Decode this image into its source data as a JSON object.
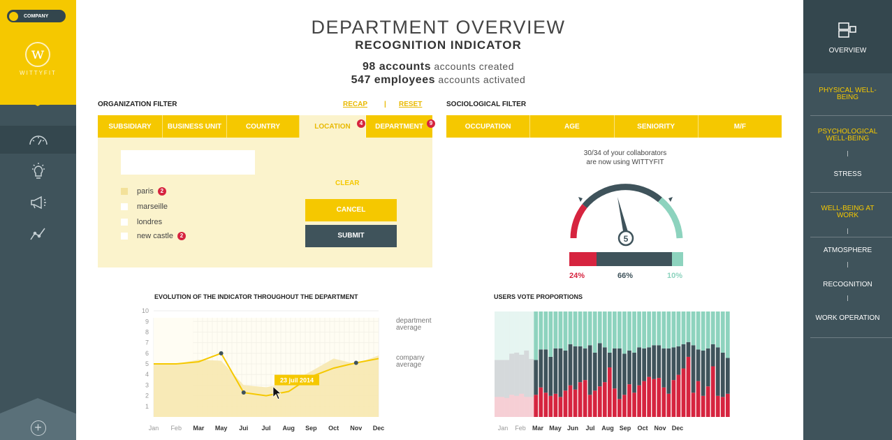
{
  "company_label": "COMPANY",
  "logo_text": "WITTYFIT",
  "header": {
    "title": "DEPARTMENT OVERVIEW",
    "subtitle": "RECOGNITION INDICATOR",
    "accounts_count": "98 accounts",
    "accounts_suffix": " accounts created",
    "employees_count": "547 employees",
    "employees_suffix": " accounts activated"
  },
  "org_filter": {
    "title": "ORGANIZATION FILTER",
    "recap": "RECAP",
    "separator": "|",
    "reset": "RESET",
    "tabs": [
      {
        "label": "SUBSIDIARY"
      },
      {
        "label": "BUSINESS UNIT"
      },
      {
        "label": "COUNTRY"
      },
      {
        "label": "LOCATION",
        "badge": "4"
      },
      {
        "label": "DEPARTMENT",
        "badge": "9"
      }
    ],
    "search_value": "",
    "locations": [
      {
        "label": "paris",
        "badge": "2",
        "checked": true
      },
      {
        "label": "marseille",
        "checked": false
      },
      {
        "label": "londres",
        "checked": false
      },
      {
        "label": "new castle",
        "badge": "2",
        "checked": false
      }
    ],
    "clear": "CLEAR",
    "cancel": "CANCEL",
    "submit": "SUBMIT"
  },
  "socio_filter": {
    "title": "SOCIOLOGICAL FILTER",
    "tabs": [
      "OCCUPATION",
      "AGE",
      "SENIORITY",
      "M/F"
    ]
  },
  "usage": {
    "line1": "30/34 of your collaborators",
    "line2": "are now using WITTYFIT"
  },
  "gauge": {
    "value": "5",
    "distribution": [
      {
        "label": "24%",
        "value": 24,
        "color": "#d6243f"
      },
      {
        "label": "66%",
        "value": 66,
        "color": "#3f535b"
      },
      {
        "label": "10%",
        "value": 10,
        "color": "#8dd3be"
      }
    ]
  },
  "right_nav": {
    "overview": "OVERVIEW",
    "items": [
      {
        "label": "PHYSICAL WELL-\nBEING",
        "type": "cat"
      },
      {
        "label": "PSYCHOLOGICAL\nWELL-BEING",
        "type": "cat"
      },
      {
        "label": "STRESS",
        "type": "sub"
      },
      {
        "label": "WELL-BEING AT\nWORK",
        "type": "cat"
      },
      {
        "label": "ATMOSPHERE",
        "type": "sub"
      },
      {
        "label": "RECOGNITION",
        "type": "sub"
      },
      {
        "label": "WORK OPERATION",
        "type": "sub"
      }
    ]
  },
  "chart_data": [
    {
      "type": "line",
      "title": "EVOLUTION OF THE INDICATOR THROUGHOUT THE DEPARTMENT",
      "categories": [
        "Jan",
        "Feb",
        "Mar",
        "May",
        "Jui",
        "Jul",
        "Aug",
        "Sep",
        "Oct",
        "Nov",
        "Dec"
      ],
      "ylim": [
        0,
        10
      ],
      "yticks": [
        "1",
        "2",
        "3",
        "4",
        "5",
        "6",
        "7",
        "8",
        "9",
        "10"
      ],
      "series": [
        {
          "name": "department average",
          "color": "#f5c800",
          "values": [
            5.0,
            5.0,
            5.2,
            6.0,
            2.3,
            2.0,
            2.4,
            3.8,
            4.6,
            5.1,
            5.5
          ]
        },
        {
          "name": "company average",
          "color": "#f7e8b0",
          "values": [
            5.0,
            5.0,
            5.4,
            5.3,
            3.0,
            2.8,
            3.2,
            4.3,
            5.5,
            5.0,
            5.8
          ]
        }
      ],
      "legend": [
        [
          "department",
          "average"
        ],
        [
          "company",
          "average"
        ]
      ],
      "tooltip": "23 juil 2014"
    },
    {
      "type": "bar",
      "title": "USERS VOTE PROPORTIONS",
      "categories": [
        "Jan",
        "Feb",
        "Mar",
        "May",
        "Jun",
        "Jul",
        "Aug",
        "Sep",
        "Oct",
        "Nov",
        "Dec"
      ],
      "ylim": [
        0,
        100
      ],
      "series": [
        {
          "name": "negative",
          "color": "#d6243f",
          "values": [
            19,
            19,
            18,
            21,
            20,
            22,
            19,
            19,
            21,
            28,
            23,
            20,
            22,
            19,
            25,
            30,
            26,
            33,
            35,
            21,
            25,
            29,
            33,
            47,
            27,
            17,
            21,
            31,
            23,
            30,
            34,
            38,
            36,
            37,
            28,
            22,
            35,
            40,
            46,
            57,
            23,
            34,
            20,
            29,
            48,
            20,
            19,
            22
          ]
        },
        {
          "name": "neutral",
          "color": "#3f535b",
          "values": [
            35,
            35,
            36,
            39,
            41,
            37,
            44,
            36,
            33,
            36,
            41,
            37,
            43,
            46,
            38,
            39,
            41,
            34,
            30,
            47,
            36,
            41,
            33,
            14,
            38,
            48,
            39,
            32,
            38,
            36,
            31,
            28,
            32,
            31,
            37,
            43,
            31,
            27,
            23,
            14,
            45,
            30,
            43,
            36,
            21,
            46,
            42,
            34
          ]
        },
        {
          "name": "positive",
          "color": "#8dd3be",
          "values": [
            46,
            46,
            46,
            40,
            39,
            41,
            37,
            45,
            46,
            36,
            36,
            43,
            35,
            35,
            37,
            31,
            33,
            33,
            35,
            32,
            39,
            30,
            34,
            39,
            35,
            35,
            40,
            37,
            39,
            34,
            35,
            34,
            32,
            32,
            35,
            35,
            34,
            33,
            31,
            29,
            32,
            36,
            37,
            35,
            31,
            34,
            39,
            44
          ]
        }
      ]
    }
  ]
}
